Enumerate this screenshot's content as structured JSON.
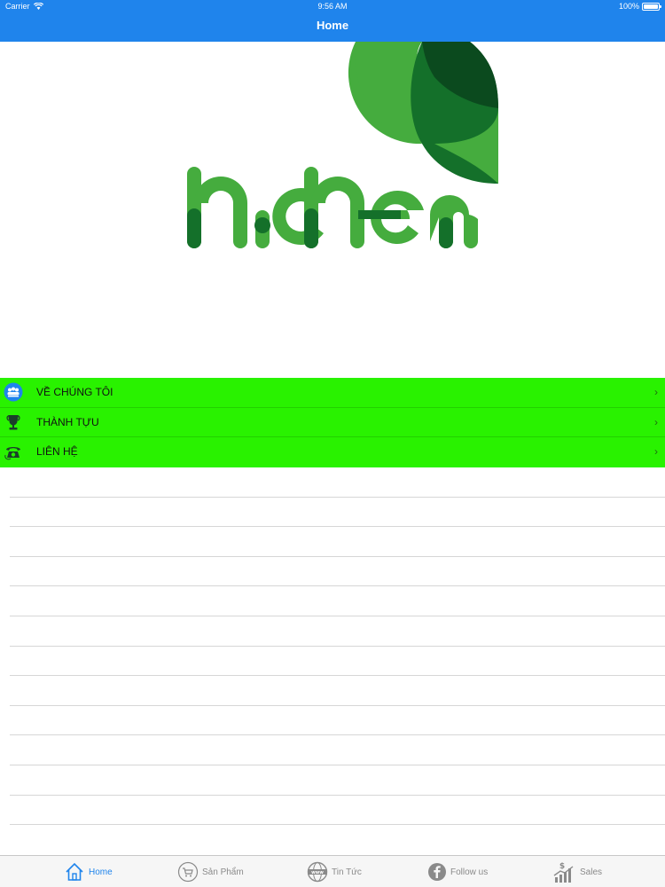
{
  "status_bar": {
    "carrier": "Carrier",
    "time": "9:56 AM",
    "battery": "100%"
  },
  "nav": {
    "title": "Home"
  },
  "logo": {
    "text": "hichem",
    "colors": {
      "light_green": "#45ac3e",
      "mid_green": "#14702a",
      "dark_green": "#0b4a1e"
    }
  },
  "menu": {
    "background": "#29f200",
    "items": [
      {
        "label": "VỀ CHÚNG TÔI",
        "icon": "team-icon"
      },
      {
        "label": "THÀNH TỰU",
        "icon": "trophy-icon"
      },
      {
        "label": "LIÊN HỆ",
        "icon": "telephone-icon"
      }
    ],
    "chevron": "›"
  },
  "tab_bar": {
    "accent": "#1f84ec",
    "tabs": [
      {
        "label": "Home",
        "icon": "home-icon",
        "active": true
      },
      {
        "label": "Sản Phẩm",
        "icon": "cart-icon",
        "active": false
      },
      {
        "label": "Tin Tức",
        "icon": "www-globe-icon",
        "active": false
      },
      {
        "label": "Follow us",
        "icon": "facebook-icon",
        "active": false
      },
      {
        "label": "Sales",
        "icon": "sales-chart-icon",
        "active": false
      }
    ]
  }
}
